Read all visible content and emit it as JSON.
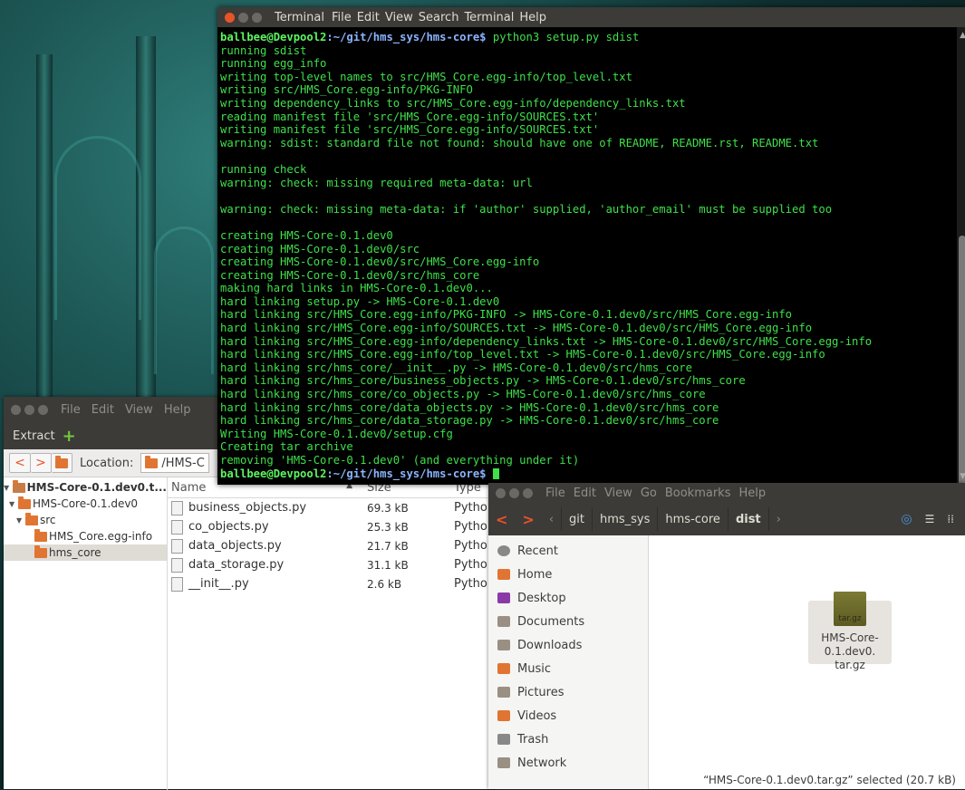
{
  "terminal": {
    "menu": [
      "Terminal",
      "File",
      "Edit",
      "View",
      "Search",
      "Terminal",
      "Help"
    ],
    "prompt_user": "ballbee@Devpool2",
    "prompt_path": ":~/git/hms_sys/hms-core$",
    "command": " python3 setup.py sdist",
    "output": "running sdist\nrunning egg_info\nwriting top-level names to src/HMS_Core.egg-info/top_level.txt\nwriting src/HMS_Core.egg-info/PKG-INFO\nwriting dependency_links to src/HMS_Core.egg-info/dependency_links.txt\nreading manifest file 'src/HMS_Core.egg-info/SOURCES.txt'\nwriting manifest file 'src/HMS_Core.egg-info/SOURCES.txt'\nwarning: sdist: standard file not found: should have one of README, README.rst, README.txt\n\nrunning check\nwarning: check: missing required meta-data: url\n\nwarning: check: missing meta-data: if 'author' supplied, 'author_email' must be supplied too\n\ncreating HMS-Core-0.1.dev0\ncreating HMS-Core-0.1.dev0/src\ncreating HMS-Core-0.1.dev0/src/HMS_Core.egg-info\ncreating HMS-Core-0.1.dev0/src/hms_core\nmaking hard links in HMS-Core-0.1.dev0...\nhard linking setup.py -> HMS-Core-0.1.dev0\nhard linking src/HMS_Core.egg-info/PKG-INFO -> HMS-Core-0.1.dev0/src/HMS_Core.egg-info\nhard linking src/HMS_Core.egg-info/SOURCES.txt -> HMS-Core-0.1.dev0/src/HMS_Core.egg-info\nhard linking src/HMS_Core.egg-info/dependency_links.txt -> HMS-Core-0.1.dev0/src/HMS_Core.egg-info\nhard linking src/HMS_Core.egg-info/top_level.txt -> HMS-Core-0.1.dev0/src/HMS_Core.egg-info\nhard linking src/hms_core/__init__.py -> HMS-Core-0.1.dev0/src/hms_core\nhard linking src/hms_core/business_objects.py -> HMS-Core-0.1.dev0/src/hms_core\nhard linking src/hms_core/co_objects.py -> HMS-Core-0.1.dev0/src/hms_core\nhard linking src/hms_core/data_objects.py -> HMS-Core-0.1.dev0/src/hms_core\nhard linking src/hms_core/data_storage.py -> HMS-Core-0.1.dev0/src/hms_core\nWriting HMS-Core-0.1.dev0/setup.cfg\nCreating tar archive\nremoving 'HMS-Core-0.1.dev0' (and everything under it)"
  },
  "archive": {
    "menu": [
      "File",
      "Edit",
      "View",
      "Help"
    ],
    "extract_label": "Extract",
    "location_label": "Location:",
    "location_value": "/HMS-C",
    "tree": [
      {
        "label": "HMS-Core-0.1.dev0.t...",
        "indent": 0
      },
      {
        "label": "HMS-Core-0.1.dev0",
        "indent": 1
      },
      {
        "label": "src",
        "indent": 2
      },
      {
        "label": "HMS_Core.egg-info",
        "indent": 3
      },
      {
        "label": "hms_core",
        "indent": 3
      }
    ],
    "columns": {
      "name": "Name",
      "size": "Size",
      "type": "Type"
    },
    "files": [
      {
        "name": "business_objects.py",
        "size": "69.3 kB",
        "type": "Python s"
      },
      {
        "name": "co_objects.py",
        "size": "25.3 kB",
        "type": "Python s"
      },
      {
        "name": "data_objects.py",
        "size": "21.7 kB",
        "type": "Python s"
      },
      {
        "name": "data_storage.py",
        "size": "31.1 kB",
        "type": "Python s"
      },
      {
        "name": "__init__.py",
        "size": "2.6 kB",
        "type": "Python s"
      }
    ]
  },
  "files_app": {
    "menu": [
      "File",
      "Edit",
      "View",
      "Go",
      "Bookmarks",
      "Help"
    ],
    "path": [
      "git",
      "hms_sys",
      "hms-core",
      "dist"
    ],
    "places": [
      {
        "label": "Recent",
        "icon": "clock-icon",
        "color": "#888"
      },
      {
        "label": "Home",
        "icon": "home-icon",
        "color": "#e07533"
      },
      {
        "label": "Desktop",
        "icon": "desktop-icon",
        "color": "#8a3aa7"
      },
      {
        "label": "Documents",
        "icon": "documents-icon",
        "color": "#9a8f83"
      },
      {
        "label": "Downloads",
        "icon": "downloads-icon",
        "color": "#9a8f83"
      },
      {
        "label": "Music",
        "icon": "music-icon",
        "color": "#e07533"
      },
      {
        "label": "Pictures",
        "icon": "pictures-icon",
        "color": "#9a8f83"
      },
      {
        "label": "Videos",
        "icon": "videos-icon",
        "color": "#e07533"
      },
      {
        "label": "Trash",
        "icon": "trash-icon",
        "color": "#888"
      },
      {
        "label": "Network",
        "icon": "network-icon",
        "color": "#9a8f83"
      }
    ],
    "file_icon_text": "tar.gz",
    "file_name": "HMS-Core-0.1.dev0.\ntar.gz",
    "status": "“HMS-Core-0.1.dev0.tar.gz” selected (20.7 kB)"
  }
}
